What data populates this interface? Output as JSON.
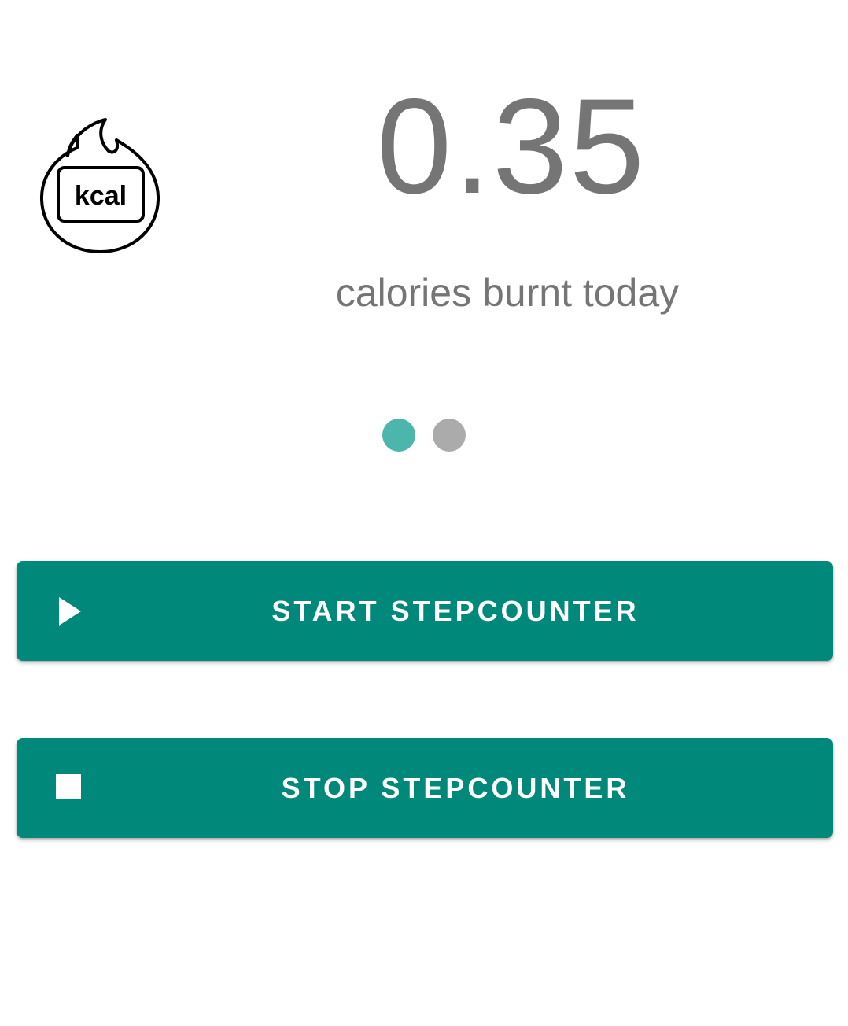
{
  "counter": {
    "value": "0.35",
    "caption": "calories burnt today",
    "icon": "kcal-flame-icon",
    "icon_text": "kcal"
  },
  "pager": {
    "pages": 2,
    "active_index": 0,
    "active_color": "#4DB6AC",
    "inactive_color": "#ABABAB"
  },
  "actions": {
    "start": {
      "label": "START STEPCOUNTER",
      "icon": "play-icon"
    },
    "stop": {
      "label": "STOP STEPCOUNTER",
      "icon": "stop-icon"
    },
    "button_color": "#00897B",
    "text_color": "#FFFFFF"
  }
}
